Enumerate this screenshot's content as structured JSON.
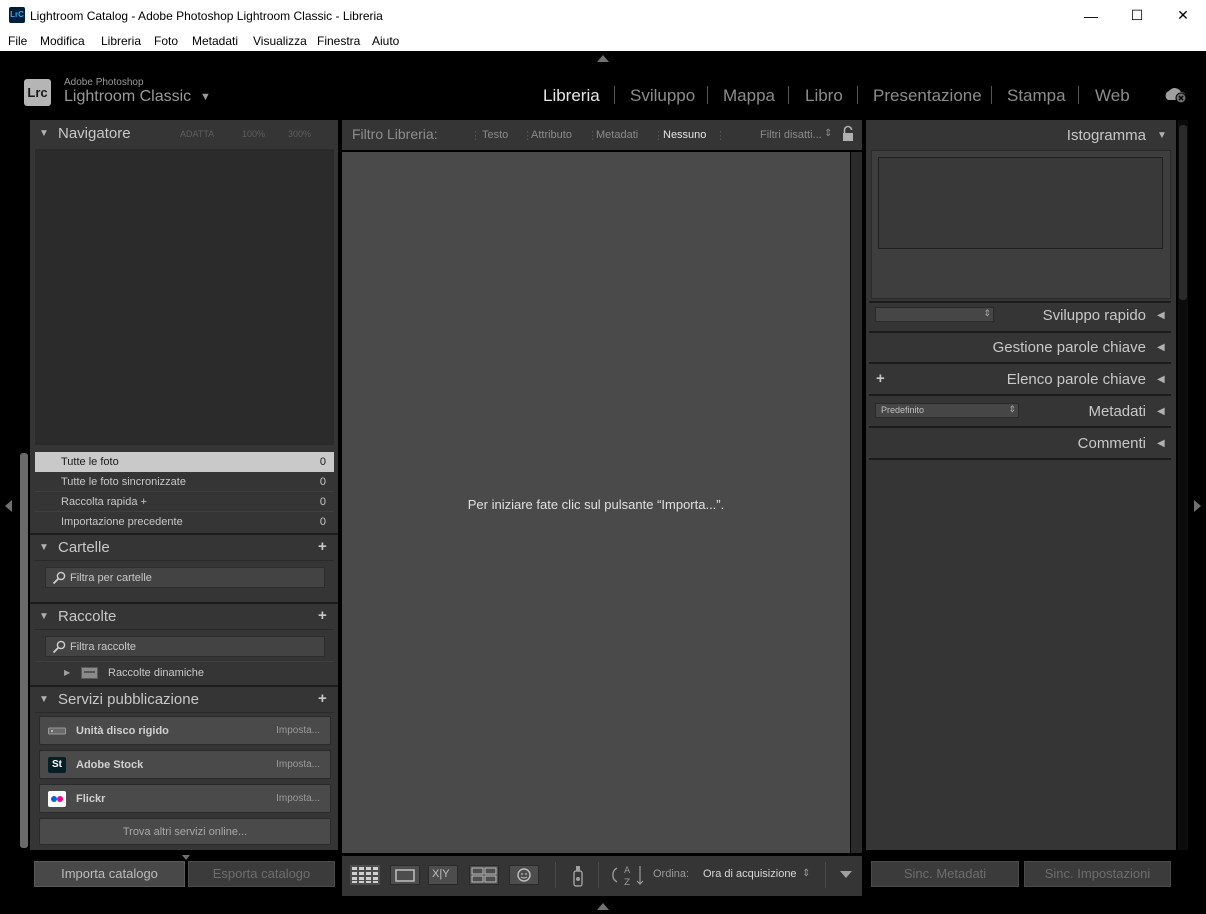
{
  "window": {
    "title": "Lightroom Catalog - Adobe Photoshop Lightroom Classic - Libreria",
    "icon_text": "LrC",
    "minimize": "—",
    "maximize": "☐",
    "close": "✕"
  },
  "menu": {
    "file": "File",
    "modifica": "Modifica",
    "libreria": "Libreria",
    "foto": "Foto",
    "metadati": "Metadati",
    "visualizza": "Visualizza",
    "finestra": "Finestra",
    "aiuto": "Aiuto"
  },
  "brand": {
    "logo": "Lrc",
    "top": "Adobe Photoshop",
    "main": "Lightroom Classic",
    "arrow": "▼"
  },
  "modules": [
    "Libreria",
    "Sviluppo",
    "Mappa",
    "Libro",
    "Presentazione",
    "Stampa",
    "Web"
  ],
  "active_module": "Libreria",
  "left": {
    "navigator": {
      "title": "Navigatore",
      "fit": "ADATTA",
      "z100": "100%",
      "z300": "300%"
    },
    "catalog": [
      {
        "label": "Tutte le foto",
        "count": "0"
      },
      {
        "label": "Tutte le foto sincronizzate",
        "count": "0"
      },
      {
        "label": "Raccolta rapida +",
        "count": "0"
      },
      {
        "label": "Importazione precedente",
        "count": "0"
      }
    ],
    "folders": {
      "title": "Cartelle",
      "search_placeholder": "Filtra per cartelle"
    },
    "collections": {
      "title": "Raccolte",
      "search_placeholder": "Filtra raccolte",
      "smart": "Raccolte dinamiche"
    },
    "publish": {
      "title": "Servizi pubblicazione",
      "services": [
        {
          "name": "Unità disco rigido",
          "action": "Imposta..."
        },
        {
          "name": "Adobe Stock",
          "action": "Imposta...",
          "icon_text": "St"
        },
        {
          "name": "Flickr",
          "action": "Imposta..."
        }
      ],
      "find_more": "Trova altri servizi online..."
    },
    "import_button": "Importa catalogo",
    "export_button": "Esporta catalogo"
  },
  "filter_bar": {
    "label": "Filtro Libreria:",
    "text": "Testo",
    "attribute": "Attributo",
    "metadata": "Metadati",
    "none": "Nessuno",
    "preset": "Filtri disatti...",
    "preset_arrow": "⇕"
  },
  "center": {
    "empty_message": "Per iniziare fate clic sul pulsante “Importa...”."
  },
  "toolbar": {
    "sort_label": "Ordina:",
    "sort_value": "Ora di acquisizione",
    "sort_arrow": "⇕",
    "compare_text": "X|Y"
  },
  "right": {
    "histogram": "Istogramma",
    "quick_develop": "Sviluppo rapido",
    "keywording": "Gestione parole chiave",
    "keyword_list": "Elenco parole chiave",
    "metadata": "Metadati",
    "metadata_preset": "Predefinito",
    "comments": "Commenti",
    "sync_metadata": "Sinc. Metadati",
    "sync_settings": "Sinc. Impostazioni"
  }
}
